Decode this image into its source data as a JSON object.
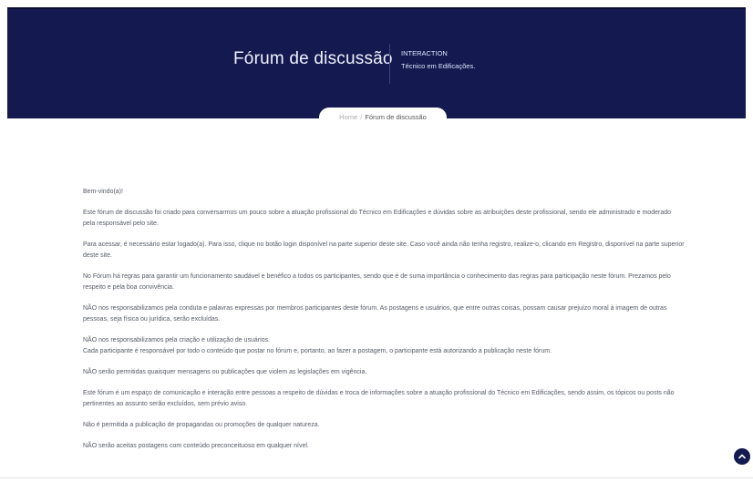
{
  "header": {
    "title": "Fórum de discussão",
    "side_line1": "INTERACTION",
    "side_line2": "Técnico em Edificações."
  },
  "breadcrumb": {
    "home": "Home",
    "separator": "/",
    "current": "Fórum de discussão"
  },
  "content": {
    "paragraphs": [
      "Bem-vindo(a)!",
      "Este fórum de discussão foi criado para conversarmos um pouco sobre a atuação profissional do Técnico em Edificações e dúvidas sobre as atribuições deste profissional, sendo ele administrado e moderado pela responsável pelo site.",
      "Para acessar, é necessário estar logado(a). Para isso, clique no botão login disponível na parte superior deste site. Caso você ainda não tenha registro, realize-o, clicando em Registro, disponível na parte superior deste site.",
      "No Fórum há regras para garantir um funcionamento saudável e benéfico a todos os participantes, sendo que é de suma importância o conhecimento das regras para participação neste fórum. Prezamos pelo respeito e pela boa convivência.",
      "NÃO nos responsabilizamos pela conduta e palavras expressas por membros participantes deste fórum. As postagens e usuários, que entre outras coisas, possam causar prejuízo moral à imagem de outras pessoas, seja física ou jurídica, serão excluídas.",
      "NÃO nos responsabilizamos pela criação e utilização de usuários.",
      "Cada participante é responsável por todo o conteúdo que postar no fórum e, portanto, ao fazer a postagem, o participante está autorizando a publicação neste fórum.",
      "NÃO serão permitidas quaisquer mensagens ou publicações que violem as legislações em vigência.",
      "Este fórum é um espaço de comunicação e interação entre pessoas a respeito de dúvidas e troca de informações sobre a atuação profissional do Técnico em Edificações, sendo assim, os tópicos ou posts não pertinentes ao assunto serão excluídos, sem prévio aviso.",
      "Não é permitida a publicação de propagandas ou promoções de qualquer natureza.",
      "NÃO serão aceitas postagens com conteúdo preconceituoso em qualquer nível."
    ]
  },
  "colors": {
    "hero_bg": "#141a4f",
    "text": "#555a66"
  },
  "icons": {
    "scroll_top": "chevron-up-icon"
  }
}
